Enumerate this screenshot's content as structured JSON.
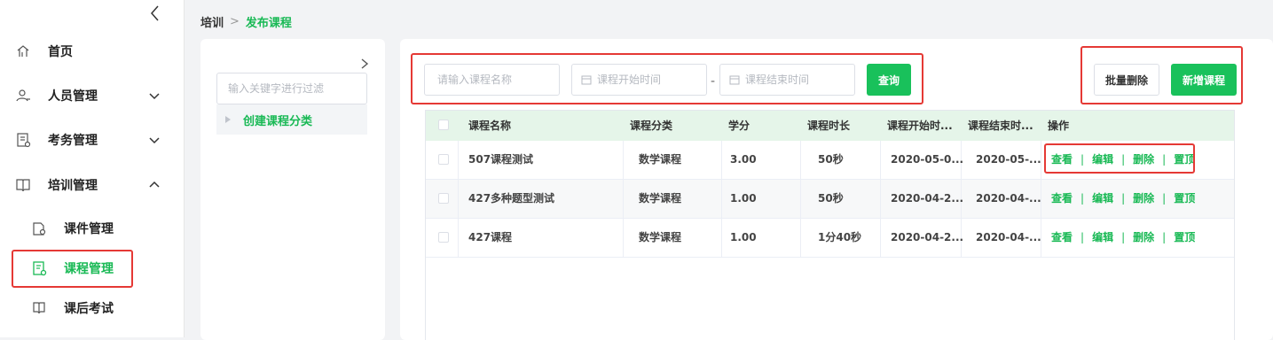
{
  "sidebar": {
    "items": [
      {
        "label": "首页",
        "icon": "home-icon"
      },
      {
        "label": "人员管理",
        "icon": "person-icon"
      },
      {
        "label": "考务管理",
        "icon": "exam-doc-icon"
      },
      {
        "label": "培训管理",
        "icon": "book-icon"
      }
    ],
    "sub_items": [
      {
        "label": "课件管理",
        "icon": "courseware-icon"
      },
      {
        "label": "课程管理",
        "icon": "course-doc-icon"
      },
      {
        "label": "课后考试",
        "icon": "exam-book-icon"
      }
    ]
  },
  "breadcrumb": {
    "root": "培训",
    "separator": ">",
    "current": "发布课程"
  },
  "category": {
    "search_placeholder": "输入关键字进行过滤",
    "node_label": "创建课程分类"
  },
  "filters": {
    "course_name_placeholder": "请输入课程名称",
    "start_placeholder": "课程开始时间",
    "end_placeholder": "课程结束时间",
    "range_separator": "-",
    "query_label": "查询"
  },
  "actions": {
    "batch_delete": "批量删除",
    "add_course": "新增课程"
  },
  "table": {
    "headers": [
      "课程名称",
      "课程分类",
      "学分",
      "课程时长",
      "课程开始时...",
      "课程结束时...",
      "操作"
    ],
    "rows": [
      {
        "name": "507课程测试",
        "category": "数学课程",
        "credit": "3.00",
        "duration": "50秒",
        "start": "2020-05-0...",
        "end": "2020-05-..."
      },
      {
        "name": "427多种题型测试",
        "category": "数学课程",
        "credit": "1.00",
        "duration": "50秒",
        "start": "2020-04-2...",
        "end": "2020-04-..."
      },
      {
        "name": "427课程",
        "category": "数学课程",
        "credit": "1.00",
        "duration": "1分40秒",
        "start": "2020-04-2...",
        "end": "2020-04-..."
      }
    ],
    "ops": {
      "view": "查看",
      "edit": "编辑",
      "delete": "删除",
      "top": "置顶",
      "sep": "|"
    }
  },
  "colors": {
    "accent": "#19c15b",
    "accent_text": "#19b955",
    "highlight_box": "#e53935",
    "header_bg": "#e5f5e9"
  }
}
